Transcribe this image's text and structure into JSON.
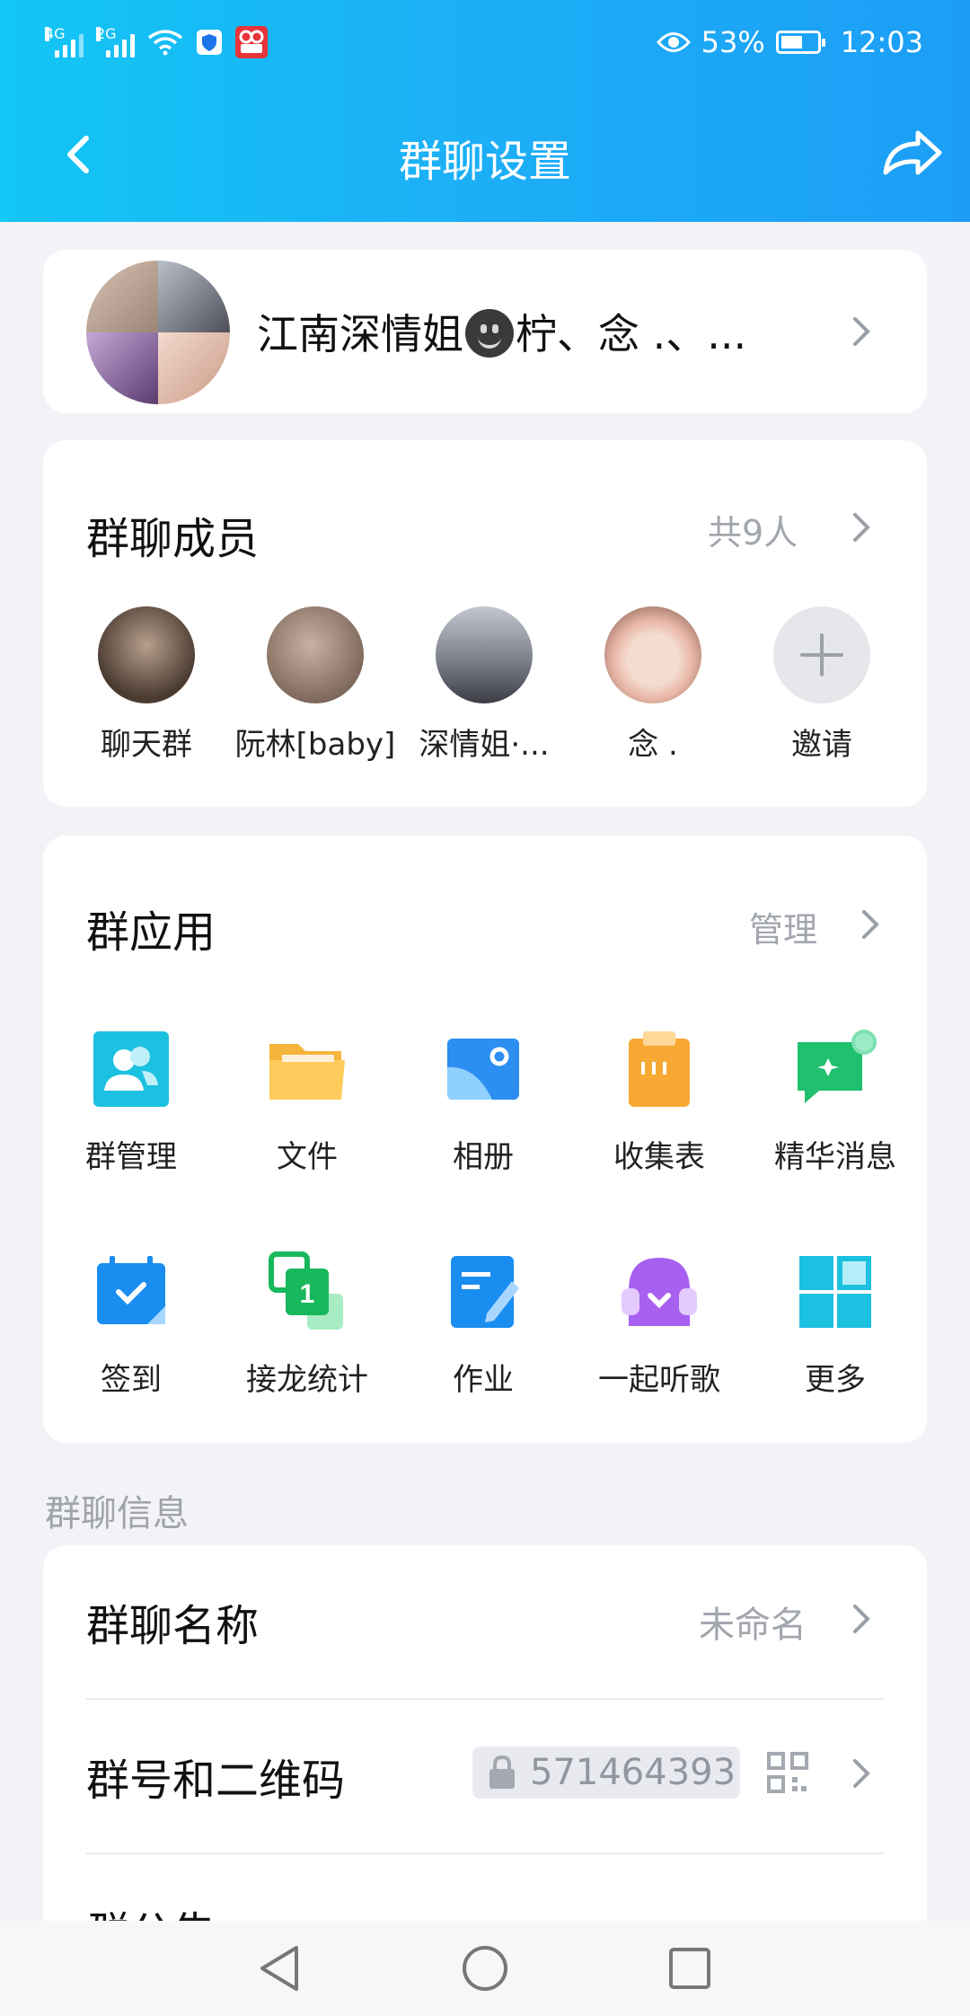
{
  "status_bar": {
    "net1": "4G",
    "net2": "2G",
    "battery": "53%",
    "time": "12:03"
  },
  "header": {
    "title": "群聊设置"
  },
  "group": {
    "name_prefix": "江南深情姐",
    "name_suffix": "柠、念 .、..."
  },
  "members": {
    "title": "群聊成员",
    "count": "共9人",
    "list": [
      {
        "name": "聊天群"
      },
      {
        "name": "阮林[baby]"
      },
      {
        "name": "深情姐·..."
      },
      {
        "name": "念 ."
      },
      {
        "name": "邀请"
      }
    ]
  },
  "apps": {
    "title": "群应用",
    "manage": "管理",
    "items": [
      {
        "label": "群管理",
        "icon": "group-manage-icon"
      },
      {
        "label": "文件",
        "icon": "folder-icon"
      },
      {
        "label": "相册",
        "icon": "album-icon"
      },
      {
        "label": "收集表",
        "icon": "clipboard-icon"
      },
      {
        "label": "精华消息",
        "icon": "essence-message-icon"
      },
      {
        "label": "签到",
        "icon": "calendar-check-icon"
      },
      {
        "label": "接龙统计",
        "icon": "chain-stat-icon"
      },
      {
        "label": "作业",
        "icon": "homework-icon"
      },
      {
        "label": "一起听歌",
        "icon": "listen-together-icon"
      },
      {
        "label": "更多",
        "icon": "grid-more-icon"
      }
    ]
  },
  "info": {
    "section_label": "群聊信息",
    "name_label": "群聊名称",
    "name_value": "未命名",
    "id_label": "群号和二维码",
    "id_value": "571464393",
    "notice_label": "群公告"
  },
  "colors": {
    "header_start": "#12c6f5",
    "header_end": "#1c9ef6",
    "background": "#f2f3f7"
  }
}
